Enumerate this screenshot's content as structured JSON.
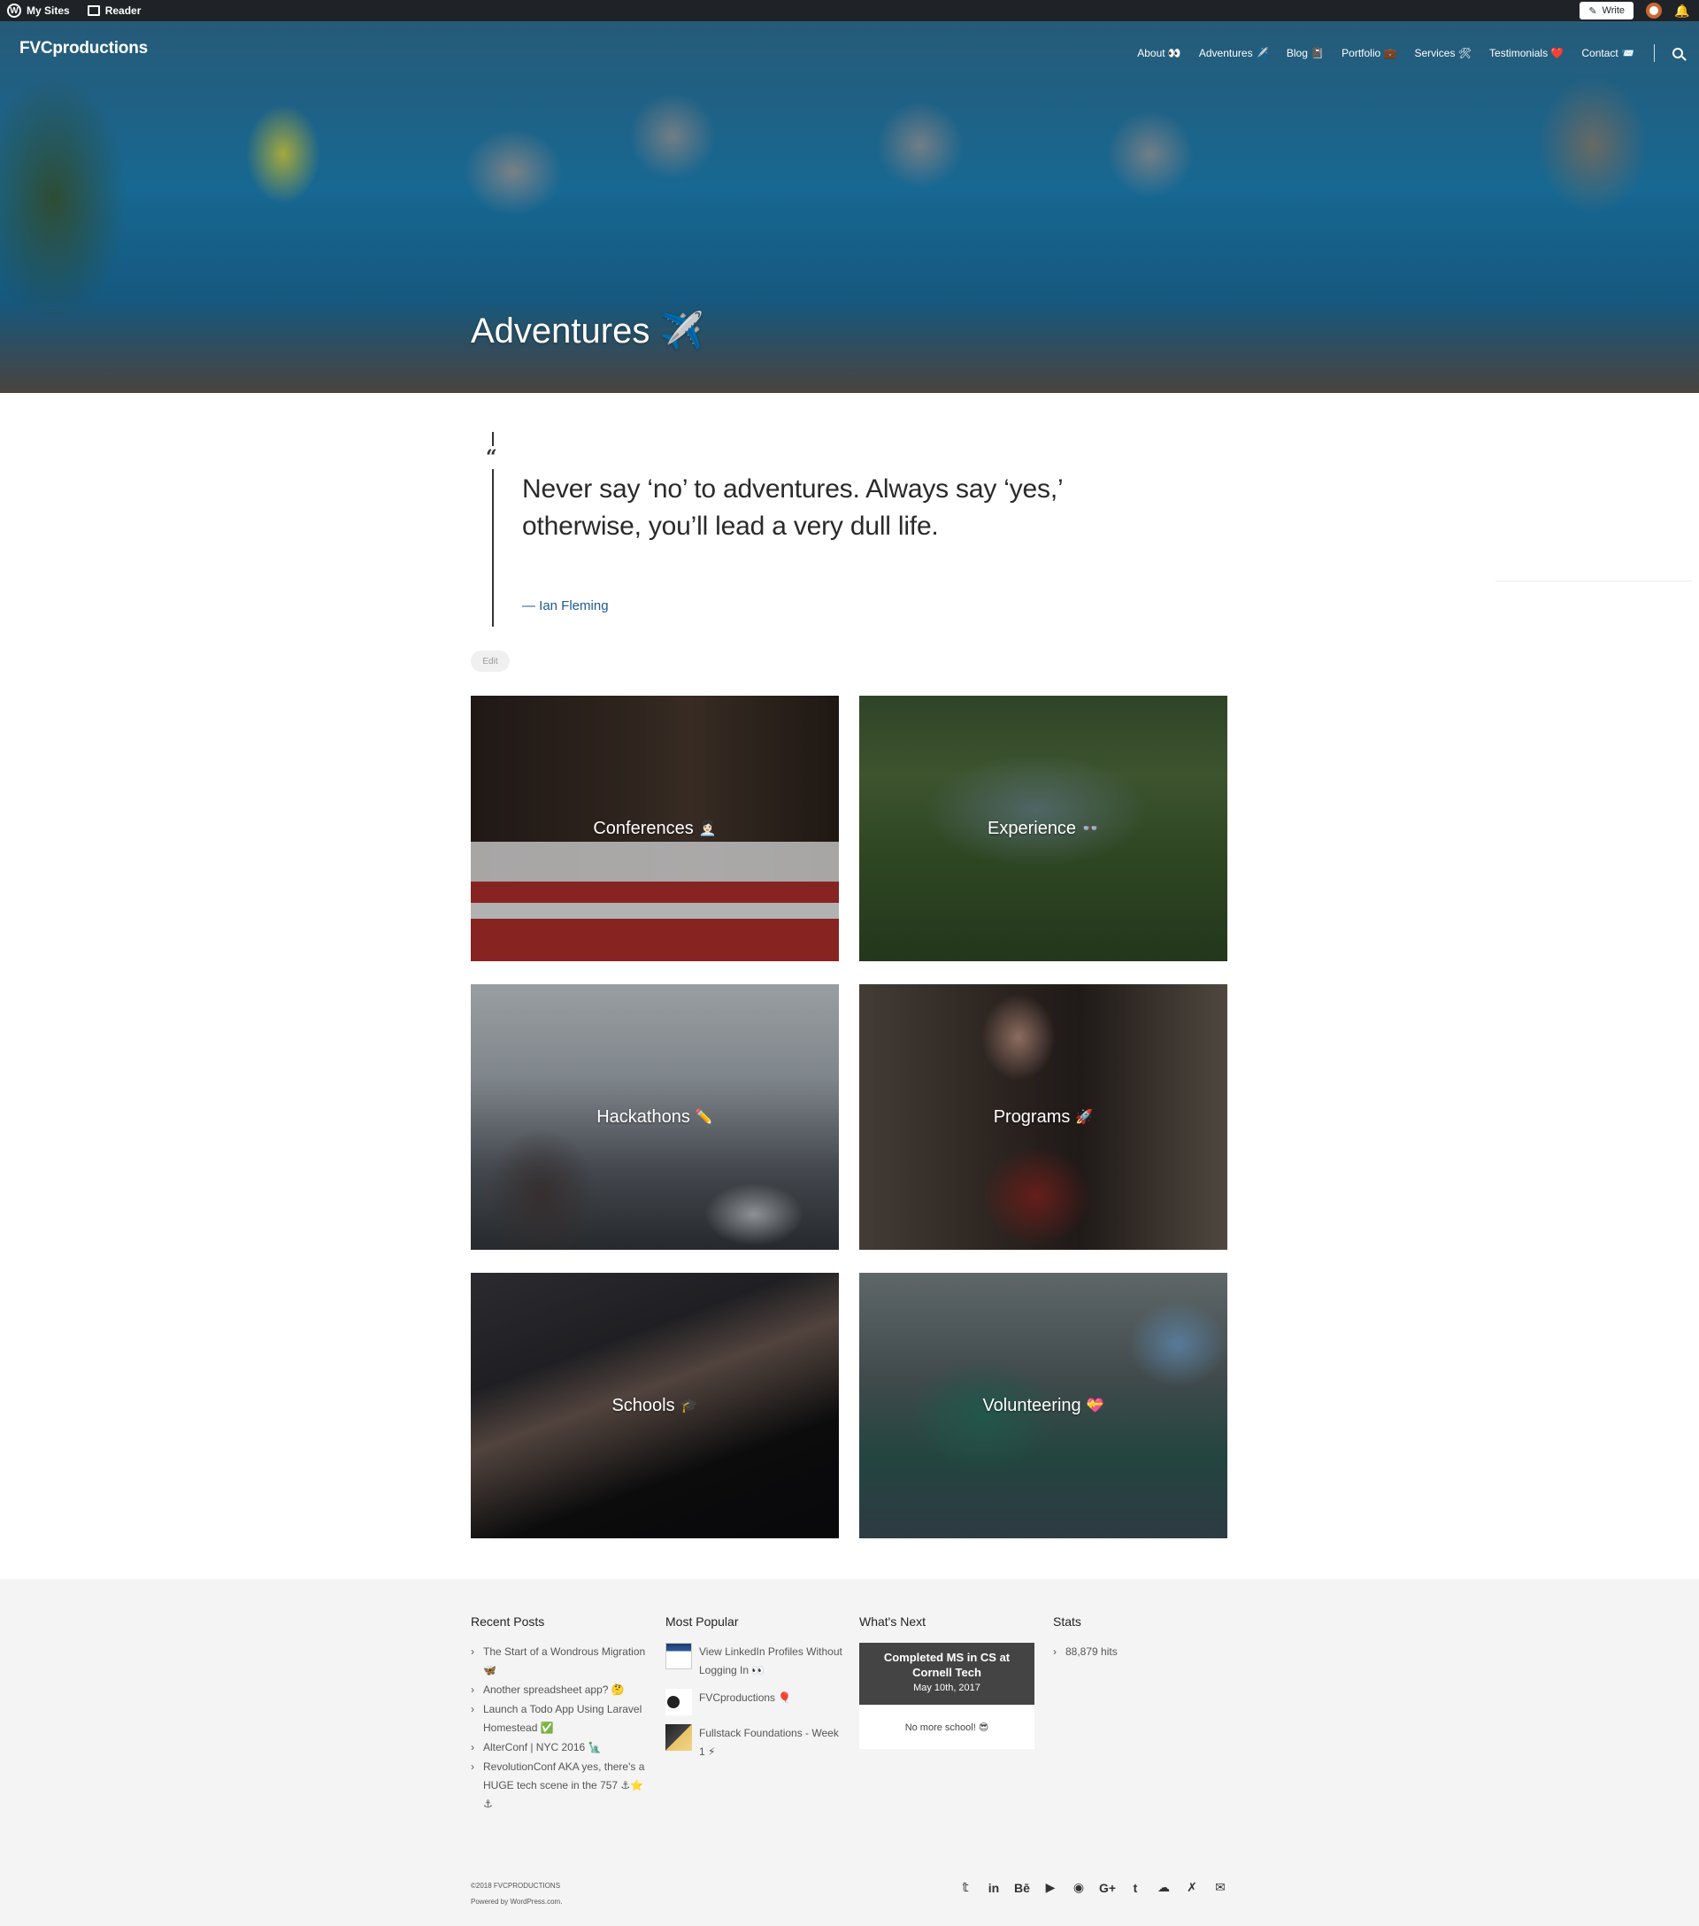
{
  "admin_bar": {
    "my_sites": "My Sites",
    "reader": "Reader",
    "write": "Write"
  },
  "site": {
    "title": "FVCproductions"
  },
  "nav": {
    "items": [
      {
        "label": "About 👀"
      },
      {
        "label": "Adventures ✈️"
      },
      {
        "label": "Blog 📓"
      },
      {
        "label": "Portfolio 💼"
      },
      {
        "label": "Services 🛠"
      },
      {
        "label": "Testimonials ❤️"
      },
      {
        "label": "Contact 📨"
      }
    ]
  },
  "page": {
    "title": "Adventures ✈️"
  },
  "quote": {
    "text": "Never say ‘no’ to adventures. Always say ‘yes,’ otherwise, you’ll lead a very dull life.",
    "cite": "— Ian Fleming"
  },
  "edit_label": "Edit",
  "tiles": [
    {
      "label": "Conferences",
      "icon": "👩🏻‍💼"
    },
    {
      "label": "Experience",
      "icon": "👓"
    },
    {
      "label": "Hackathons",
      "icon": "✏️"
    },
    {
      "label": "Programs",
      "icon": "🚀"
    },
    {
      "label": "Schools",
      "icon": "🎓"
    },
    {
      "label": "Volunteering",
      "icon": "💝"
    }
  ],
  "footer": {
    "recent_posts": {
      "title": "Recent Posts",
      "items": [
        {
          "label": "The Start of a Wondrous Migration 🦋"
        },
        {
          "label": "Another spreadsheet app? 🤔"
        },
        {
          "label": "Launch a Todo App Using Laravel Homestead ✅"
        },
        {
          "label": "AlterConf | NYC 2016 🗽"
        },
        {
          "label": "RevolutionConf AKA yes, there's a HUGE tech scene in the 757 ⚓⭐ ⚓"
        }
      ]
    },
    "most_popular": {
      "title": "Most Popular",
      "items": [
        {
          "label": "View LinkedIn Profiles Without Logging In 👀"
        },
        {
          "label": "FVCproductions 🎈"
        },
        {
          "label": "Fullstack Foundations - Week 1 ⚡"
        }
      ]
    },
    "whats_next": {
      "title": "What's Next",
      "event_title": "Completed MS in CS at Cornell Tech",
      "event_date": "May 10th, 2017",
      "event_note": "No more school! 😎"
    },
    "stats": {
      "title": "Stats",
      "hits": "88,879 hits"
    },
    "copyright": "©2018 FVCPRODUCTIONS",
    "powered": "Powered by WordPress.com.",
    "social_icons": [
      "twitter-icon",
      "linkedin-icon",
      "behance-icon",
      "youtube-icon",
      "github-icon",
      "google-plus-icon",
      "tumblr-icon",
      "soundcloud-icon",
      "codepen-icon",
      "email-icon"
    ]
  }
}
